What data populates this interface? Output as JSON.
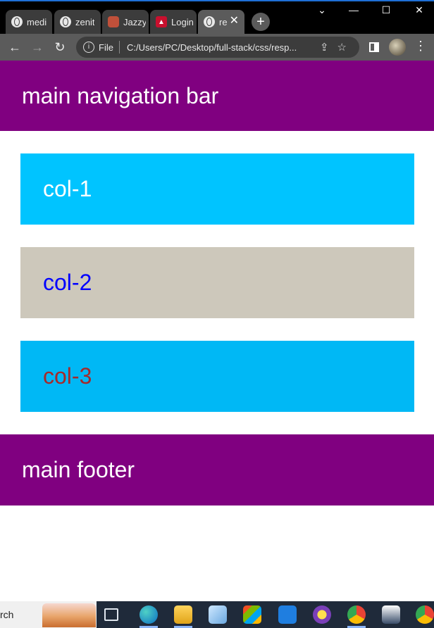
{
  "browser": {
    "tabs": [
      {
        "title": "medi",
        "icon": "globe-icon",
        "active": false
      },
      {
        "title": "zenit",
        "icon": "globe-icon",
        "active": false
      },
      {
        "title": "Jazzy",
        "icon": "jazzy-favicon-icon",
        "active": false
      },
      {
        "title": "Login",
        "icon": "login-favicon-icon",
        "active": false
      },
      {
        "title": "re",
        "icon": "globe-icon",
        "active": true
      }
    ],
    "new_tab_label": "+",
    "window_controls": {
      "chevron": "⌄",
      "minimize": "—",
      "maximize": "☐",
      "close": "✕"
    },
    "nav": {
      "back": "←",
      "forward": "→",
      "reload": "↻"
    },
    "omnibox": {
      "scheme_label": "File",
      "url": "C:/Users/PC/Desktop/full-stack/css/resp...",
      "info_icon": "i",
      "share_icon": "⇪",
      "star_icon": "☆"
    },
    "menu_icon": "⋮"
  },
  "page": {
    "nav_text": "main navigation bar",
    "col1_text": "col-1",
    "col2_text": "col-2",
    "col3_text": "col-3",
    "footer_text": "main footer"
  },
  "colors": {
    "nav_bg": "#800080",
    "col1_bg": "#00c4ff",
    "col2_bg": "#cdc8bb",
    "col3_bg": "#00b8f5",
    "col2_text": "#0000ff",
    "col3_text": "#a52a2a"
  },
  "taskbar": {
    "search_text": "rch",
    "apps": [
      "task-view-icon",
      "edge-icon",
      "file-explorer-icon",
      "notepad-icon",
      "store-icon",
      "mail-icon",
      "keepass-icon",
      "chrome-icon",
      "figure-app-icon",
      "chrome-icon"
    ]
  }
}
